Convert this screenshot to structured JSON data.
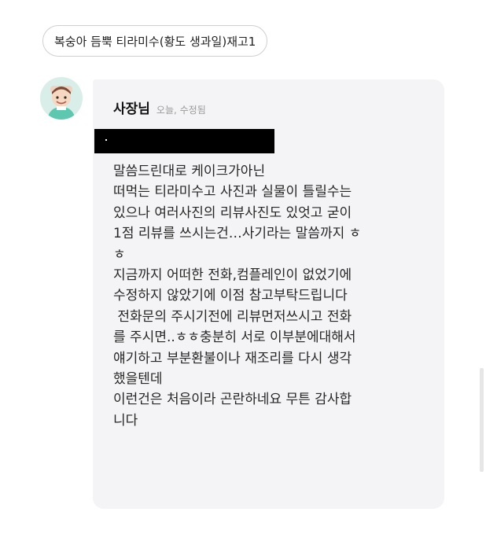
{
  "order": {
    "menu_item": "복숭아 듬뿍 티라미수(황도 생과일)재고1"
  },
  "reply": {
    "author": "사장님",
    "meta": "오늘, 수정됨",
    "lines": [
      "말씀드린대로 케이크가아닌",
      "떠먹는 티라미수고 사진과 실물이 틀릴수는",
      "있으나 여러사진의 리뷰사진도 있엇고 굳이",
      "1점 리뷰를 쓰시는건…사기라는 말씀까지 ㅎ",
      "ㅎ",
      "지금까지 어떠한 전화,컴플레인이 없었기에",
      "수정하지 않았기에 이점 참고부탁드립니다",
      " 전화문의 주시기전에 리뷰먼저쓰시고 전화",
      "를 주시면..ㅎㅎ충분히 서로 이부분에대해서",
      "얘기하고 부분환불이나 재조리를 다시 생각",
      "했을텐데",
      "이런건은 처음이라 곤란하네요 무튼 감사합",
      "니다"
    ]
  },
  "colors": {
    "bubble_background": "#f4f4f6",
    "redaction": "#000000",
    "meta_text": "#9a9a9a"
  },
  "icons": {
    "avatar": "owner-avatar-icon"
  }
}
